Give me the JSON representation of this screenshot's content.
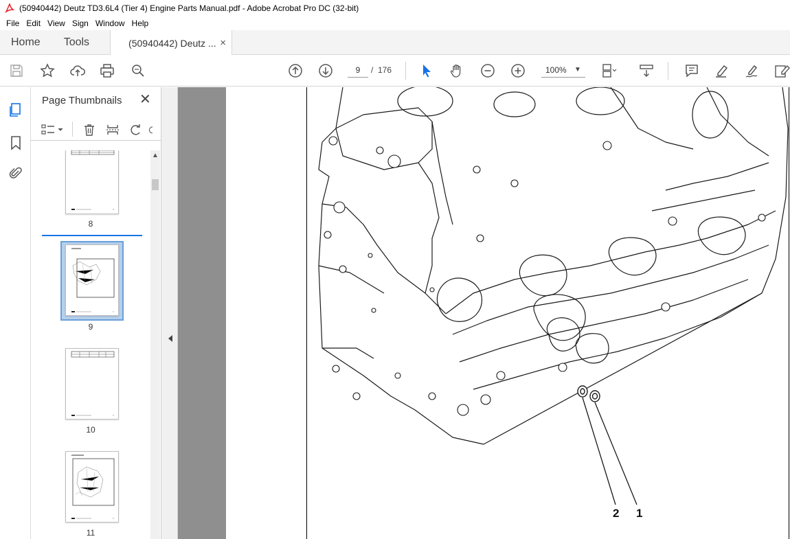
{
  "window": {
    "title": "(50940442) Deutz TD3.6L4 (Tier 4) Engine Parts Manual.pdf - Adobe Acrobat Pro DC (32-bit)"
  },
  "menu": [
    "File",
    "Edit",
    "View",
    "Sign",
    "Window",
    "Help"
  ],
  "tabs": {
    "home": "Home",
    "tools": "Tools",
    "document": "(50940442) Deutz ...",
    "close": "×"
  },
  "toolbar": {
    "current_page": "9",
    "page_separator": "/",
    "total_pages": "176",
    "zoom": "100%"
  },
  "panel": {
    "title": "Page Thumbnails",
    "close": "✕",
    "thumbnails": [
      {
        "label": "8"
      },
      {
        "label": "9"
      },
      {
        "label": "10"
      },
      {
        "label": "11"
      }
    ],
    "selected_page": "9"
  },
  "document": {
    "callouts": [
      "2",
      "1"
    ]
  },
  "colors": {
    "accent": "#1473e6",
    "pdf_red": "#e8161e",
    "doc_background": "#8f8f8f"
  }
}
